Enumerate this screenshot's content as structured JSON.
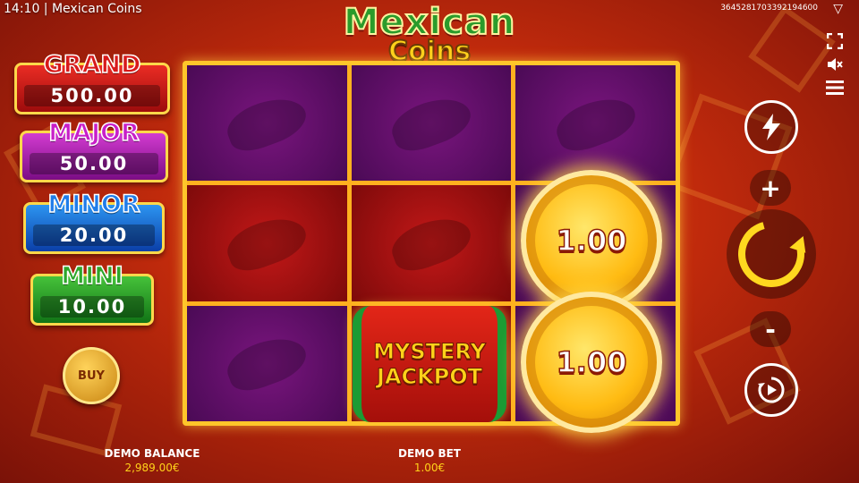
{
  "status_bar": {
    "title": "14:10 | Mexican Coins",
    "session_id": "3645281703392194600",
    "brand_icon": "▽",
    "icons": [
      "fullscreen-icon",
      "sound-off-icon",
      "menu-icon"
    ]
  },
  "logo": {
    "line1": "Mexican",
    "line2": "Coins"
  },
  "jackpots": [
    {
      "name": "GRAND",
      "value": "500.00",
      "color": "#d81a1a"
    },
    {
      "name": "MAJOR",
      "value": "50.00",
      "color": "#c81ec8"
    },
    {
      "name": "MINOR",
      "value": "20.00",
      "color": "#1f7ce8"
    },
    {
      "name": "MINI",
      "value": "10.00",
      "color": "#2ea62a"
    }
  ],
  "buy_button": {
    "label": "BUY"
  },
  "reels": {
    "rows": [
      [
        "purple",
        "purple",
        "purple"
      ],
      [
        "red",
        "red",
        "coin"
      ],
      [
        "purple",
        "mystery",
        "coin"
      ]
    ],
    "coins": [
      "1.00",
      "1.00"
    ],
    "mystery": {
      "line1": "MYSTERY",
      "line2": "JACKPOT"
    }
  },
  "controls": {
    "turbo_icon": "lightning-icon",
    "plus": "+",
    "minus": "-",
    "spin_icon": "spin-icon",
    "autoplay_icon": "autoplay-icon"
  },
  "footer": {
    "balance_label": "DEMO BALANCE",
    "balance_value": "2,989.00€",
    "bet_label": "DEMO BET",
    "bet_value": "1.00€"
  }
}
